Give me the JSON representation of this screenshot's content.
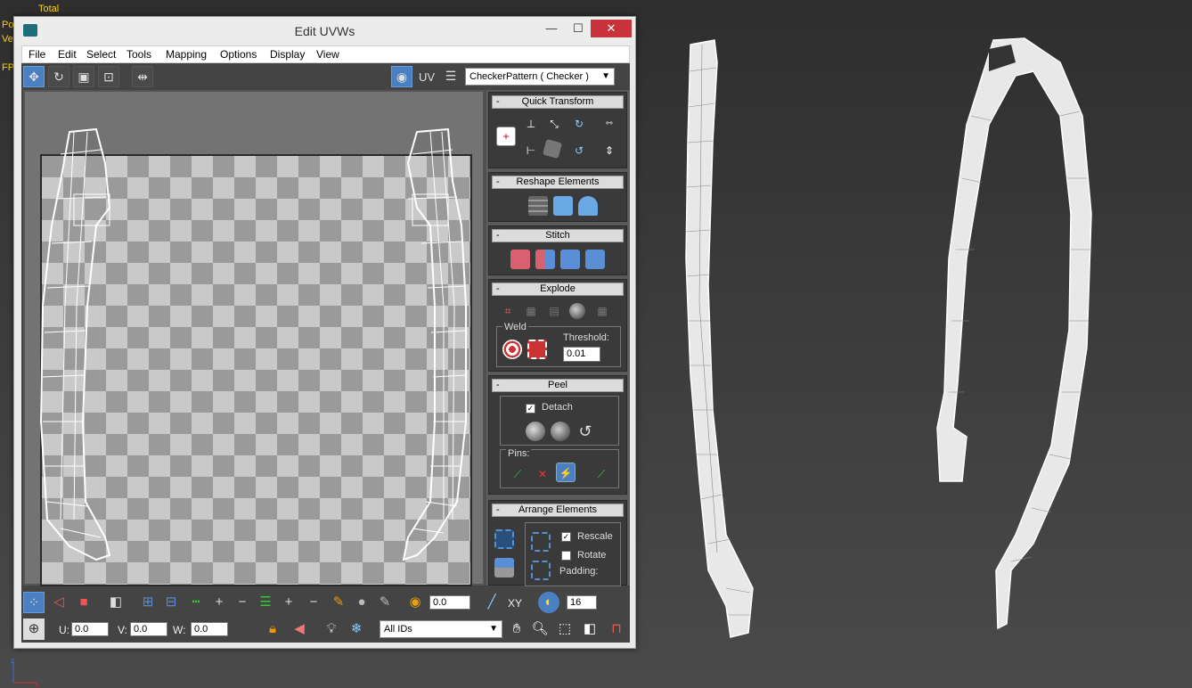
{
  "viewport_labels": {
    "total": "Total",
    "po": "Po",
    "ve": "Ve",
    "fp": "FP"
  },
  "window": {
    "title": "Edit UVWs",
    "minimize": "—",
    "maximize": "☐",
    "close": "✕"
  },
  "menu": [
    "File",
    "Edit",
    "Select",
    "Tools",
    "Mapping",
    "Options",
    "Display",
    "View"
  ],
  "toolbar": {
    "uv_label": "UV",
    "texture_select": "CheckerPattern  ( Checker )"
  },
  "rollouts": {
    "quick_transform": "Quick Transform",
    "reshape_elements": "Reshape Elements",
    "stitch": "Stitch",
    "explode": "Explode",
    "weld_label": "Weld",
    "threshold_label": "Threshold:",
    "threshold_value": "0.01",
    "peel": "Peel",
    "detach_label": "Detach",
    "detach_checked": true,
    "pins_label": "Pins:",
    "arrange_elements": "Arrange Elements",
    "rescale_label": "Rescale",
    "rescale_checked": true,
    "rotate_label": "Rotate",
    "rotate_checked": false,
    "padding_label": "Padding:"
  },
  "bottom_toolbar": {
    "soft_value": "0.0",
    "xy_label": "XY",
    "grid_value": "16",
    "u_label": "U:",
    "u_value": "0.0",
    "v_label": "V:",
    "v_value": "0.0",
    "w_label": "W:",
    "w_value": "0.0",
    "id_select": "All IDs"
  },
  "colors": {
    "accent": "#4a7fc1",
    "close": "#c8323a",
    "viewport_text": "#ffd400"
  }
}
